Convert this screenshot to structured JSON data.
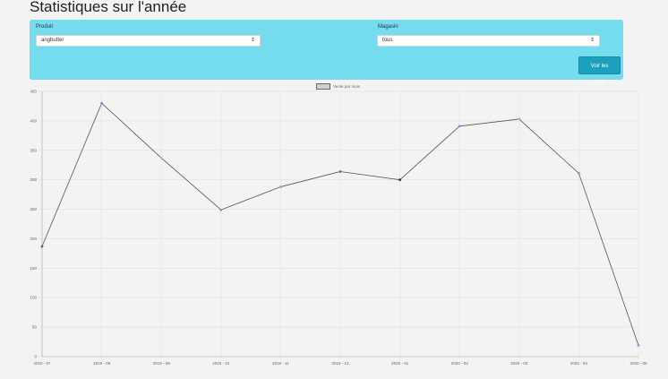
{
  "page": {
    "title": "Statistiques sur l'année"
  },
  "filters": {
    "product": {
      "label": "Produit",
      "value": "angbutter",
      "arrow": "⇕"
    },
    "store": {
      "label": "Magasin",
      "value": "tous",
      "arrow": "⇕"
    },
    "submit_label": "Voir les stats"
  },
  "chart_data": {
    "type": "line",
    "legend": {
      "label": "Vente par mois",
      "position": "top"
    },
    "categories": [
      "2019 - 07",
      "2019 - 08",
      "2019 - 09",
      "2019 - 10",
      "2019 - 11",
      "2019 - 12",
      "2020 - 01",
      "2020 - 02",
      "2020 - 03",
      "2020 - 04",
      "2020 - 05"
    ],
    "series": [
      {
        "name": "Vente par mois",
        "values": [
          187,
          430,
          337,
          249,
          288,
          314,
          300,
          391,
          403,
          311,
          19
        ],
        "line_color": "#555555",
        "point_colors": [
          "#6a5a8c",
          "#6a8fd8",
          "#c8c266",
          "#7d95d6",
          "#8aa0da",
          "#777777",
          "#333333",
          "#6a9ee0",
          "#c8b07a",
          "#76b06a",
          "#9a8ee0"
        ]
      }
    ],
    "y_ticks": [
      0,
      50,
      100,
      150,
      200,
      250,
      300,
      350,
      400,
      450
    ],
    "ylim": [
      0,
      450
    ],
    "grid": true
  }
}
